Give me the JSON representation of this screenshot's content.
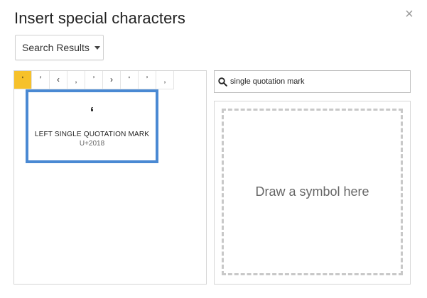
{
  "dialog": {
    "title": "Insert special characters",
    "close_glyph": "×"
  },
  "category_dropdown": {
    "selected": "Search Results"
  },
  "results": {
    "chips": [
      "‘",
      "′",
      "‹",
      "‚",
      "’",
      "›",
      "‘",
      "’",
      "‚"
    ],
    "selected_index": 0,
    "highlighted": {
      "glyph": "‘",
      "name": "LEFT SINGLE QUOTATION MARK",
      "code": "U+2018"
    }
  },
  "search": {
    "value": "single quotation mark",
    "icon": "search-icon"
  },
  "draw": {
    "prompt": "Draw a symbol here"
  },
  "colors": {
    "selected_chip": "#f6c12b",
    "highlight_border": "#4a89d3"
  }
}
